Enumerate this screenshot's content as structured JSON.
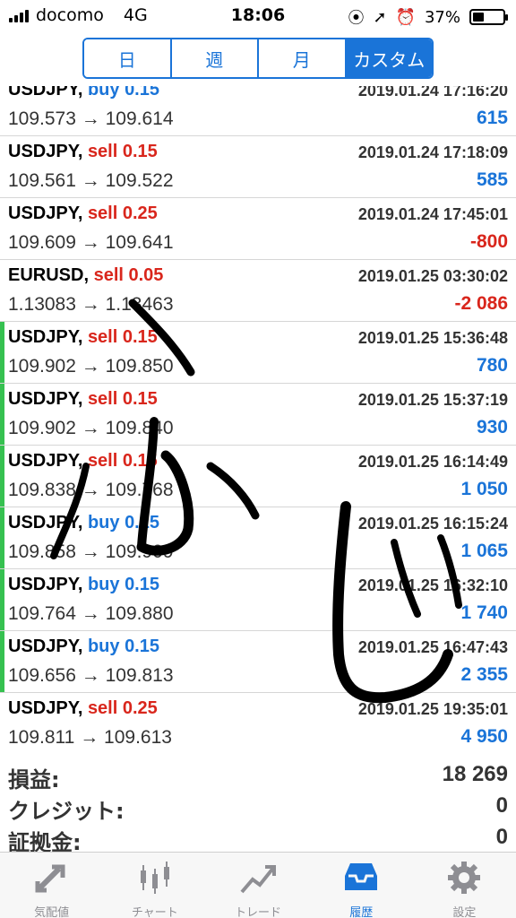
{
  "status_bar": {
    "carrier": "docomo",
    "network": "4G",
    "time": "18:06",
    "battery_percent": "37%",
    "battery_level": 0.37
  },
  "period_tabs": [
    {
      "label": "日",
      "active": false
    },
    {
      "label": "週",
      "active": false
    },
    {
      "label": "月",
      "active": false
    },
    {
      "label": "カスタム",
      "active": true
    }
  ],
  "trades": [
    {
      "symbol": "USDJPY,",
      "side": "buy",
      "volume": "0.15",
      "time": "2019.01.24 17:16:20",
      "open": "109.573",
      "close": "109.614",
      "profit": "615",
      "marked": false
    },
    {
      "symbol": "USDJPY,",
      "side": "sell",
      "volume": "0.15",
      "time": "2019.01.24 17:18:09",
      "open": "109.561",
      "close": "109.522",
      "profit": "585",
      "marked": false
    },
    {
      "symbol": "USDJPY,",
      "side": "sell",
      "volume": "0.25",
      "time": "2019.01.24 17:45:01",
      "open": "109.609",
      "close": "109.641",
      "profit": "-800",
      "marked": false
    },
    {
      "symbol": "EURUSD,",
      "side": "sell",
      "volume": "0.05",
      "time": "2019.01.25 03:30:02",
      "open": "1.13083",
      "close": "1.13463",
      "profit": "-2 086",
      "marked": false
    },
    {
      "symbol": "USDJPY,",
      "side": "sell",
      "volume": "0.15",
      "time": "2019.01.25 15:36:48",
      "open": "109.902",
      "close": "109.850",
      "profit": "780",
      "marked": true
    },
    {
      "symbol": "USDJPY,",
      "side": "sell",
      "volume": "0.15",
      "time": "2019.01.25 15:37:19",
      "open": "109.902",
      "close": "109.840",
      "profit": "930",
      "marked": true
    },
    {
      "symbol": "USDJPY,",
      "side": "sell",
      "volume": "0.15",
      "time": "2019.01.25 16:14:49",
      "open": "109.838",
      "close": "109.768",
      "profit": "1 050",
      "marked": true
    },
    {
      "symbol": "USDJPY,",
      "side": "buy",
      "volume": "0.15",
      "time": "2019.01.25 16:15:24",
      "open": "109.858",
      "close": "109.909",
      "profit": "1 065",
      "marked": true
    },
    {
      "symbol": "USDJPY,",
      "side": "buy",
      "volume": "0.15",
      "time": "2019.01.25 16:32:10",
      "open": "109.764",
      "close": "109.880",
      "profit": "1 740",
      "marked": true
    },
    {
      "symbol": "USDJPY,",
      "side": "buy",
      "volume": "0.15",
      "time": "2019.01.25 16:47:43",
      "open": "109.656",
      "close": "109.813",
      "profit": "2 355",
      "marked": true
    },
    {
      "symbol": "USDJPY,",
      "side": "sell",
      "volume": "0.25",
      "time": "2019.01.25 19:35:01",
      "open": "109.811",
      "close": "109.613",
      "profit": "4 950",
      "marked": false
    }
  ],
  "arrow": "→",
  "summary": [
    {
      "label": "損益:",
      "value": "18 269"
    },
    {
      "label": "クレジット:",
      "value": "0"
    },
    {
      "label": "証拠金:",
      "value": "0"
    }
  ],
  "tabbar": [
    {
      "label": "気配値",
      "icon": "quotes-icon",
      "active": false
    },
    {
      "label": "チャート",
      "icon": "chart-icon",
      "active": false
    },
    {
      "label": "トレード",
      "icon": "trade-icon",
      "active": false
    },
    {
      "label": "履歴",
      "icon": "history-icon",
      "active": true
    },
    {
      "label": "設定",
      "icon": "settings-icon",
      "active": false
    }
  ],
  "colors": {
    "accent": "#1a74d8",
    "sell": "#d9261c",
    "marker": "#36c150"
  }
}
